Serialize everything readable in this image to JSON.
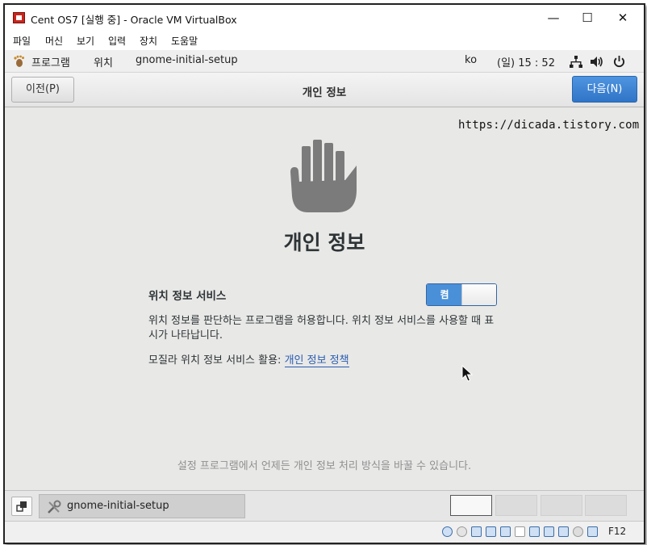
{
  "window": {
    "title": "Cent OS7 [실행 중] - Oracle VM VirtualBox",
    "minimize": "—",
    "maximize": "☐",
    "close": "✕"
  },
  "menubar": {
    "items": [
      "파일",
      "머신",
      "보기",
      "입력",
      "장치",
      "도움말"
    ]
  },
  "topbar": {
    "applications": "프로그램",
    "places": "위치",
    "active_app": "gnome-initial-setup",
    "input_method": "ko",
    "clock": "(일) 15 : 52"
  },
  "header": {
    "prev_label": "이전(P)",
    "title": "개인 정보",
    "next_label": "다음(N)"
  },
  "content": {
    "watermark": "https://dicada.tistory.com",
    "heading": "개인 정보",
    "location_label": "위치 정보 서비스",
    "switch_on_label": "켬",
    "description": "위치 정보를 판단하는 프로그램을 허용합니다. 위치 정보 서비스를 사용할 때 표시가 나타납니다.",
    "policy_prefix": "모질라 위치 정보 서비스 활용: ",
    "policy_link": "개인 정보 정책",
    "footer_note": "설정 프로그램에서 언제든 개인 정보 처리 방식을 바꿀 수 있습니다."
  },
  "taskbar": {
    "task_label": "gnome-initial-setup"
  },
  "statusbar": {
    "host_key": "F12"
  },
  "colors": {
    "accent": "#4a90d9",
    "next_button": "#3b82d1",
    "link": "#2a5db0",
    "content_bg": "#e8e8e7"
  },
  "icons": [
    "virtualbox-icon",
    "gnome-foot-icon",
    "network-icon",
    "volume-icon",
    "power-icon",
    "hand-icon",
    "show-desktop-icon",
    "setup-tool-icon"
  ]
}
